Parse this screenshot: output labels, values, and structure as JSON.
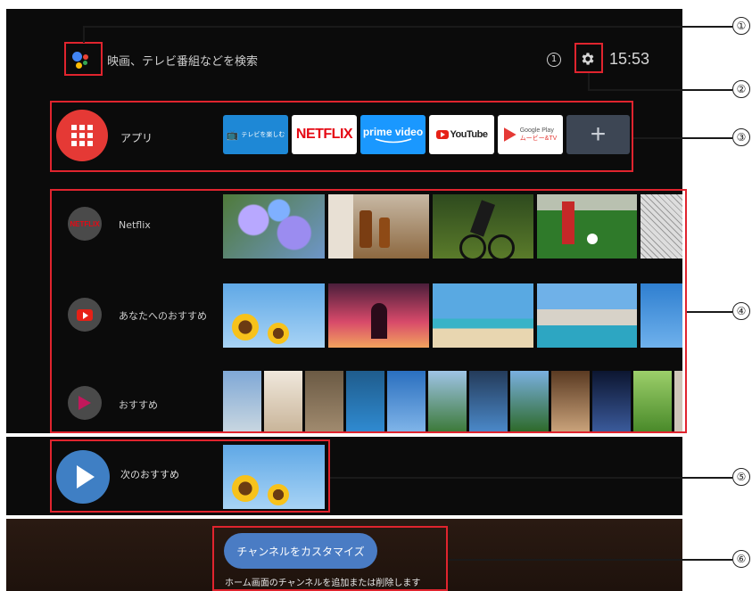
{
  "header": {
    "search_placeholder": "映画、テレビ番組などを検索",
    "notification_badge": "1",
    "clock": "15:53",
    "settings_icon": "gear-icon",
    "assistant_icon": "google-assistant-icon"
  },
  "apps_row": {
    "label": "アプリ",
    "apps": [
      {
        "label": "テレビを楽しむ"
      },
      {
        "label": "NETFLIX"
      },
      {
        "label": "prime video"
      },
      {
        "label": "YouTube"
      },
      {
        "label": "Google Play",
        "sublabel": "ムービー&TV"
      },
      {
        "label": "+"
      }
    ]
  },
  "channels": [
    {
      "label": "Netflix",
      "icon_text": "NETFLIX"
    },
    {
      "label": "あなたへのおすすめ"
    },
    {
      "label": "おすすめ"
    }
  ],
  "play_next": {
    "label": "次のおすすめ"
  },
  "customize": {
    "button_label": "チャンネルをカスタマイズ",
    "description": "ホーム画面のチャンネルを追加または削除します"
  },
  "callouts": [
    "①",
    "②",
    "③",
    "④",
    "⑤",
    "⑥"
  ],
  "colors": {
    "highlight": "#e0242e",
    "apps_circle": "#e53935",
    "play_circle": "#3f7fc4",
    "customize_button": "#4a7cc4"
  }
}
